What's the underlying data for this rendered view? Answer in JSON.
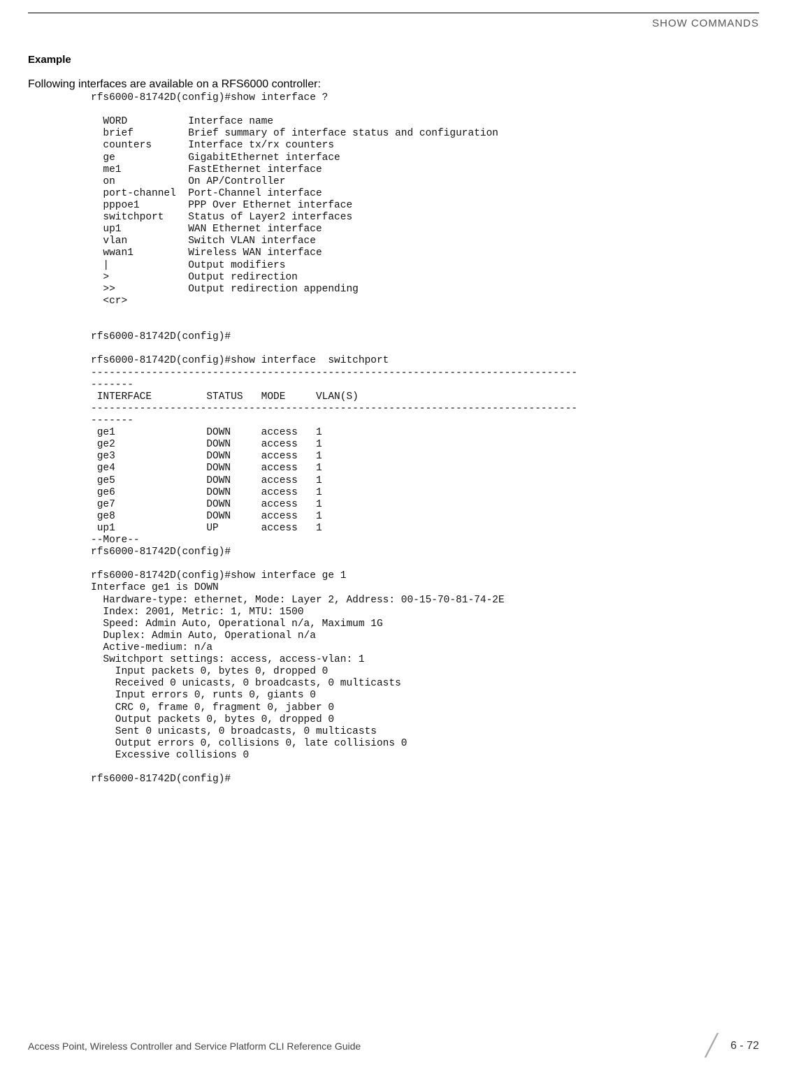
{
  "header": {
    "section_title": "SHOW COMMANDS"
  },
  "body": {
    "heading": "Example",
    "intro": "Following interfaces are available on a RFS6000 controller:",
    "cli": "rfs6000-81742D(config)#show interface ?\n\n  WORD          Interface name\n  brief         Brief summary of interface status and configuration\n  counters      Interface tx/rx counters\n  ge            GigabitEthernet interface\n  me1           FastEthernet interface\n  on            On AP/Controller\n  port-channel  Port-Channel interface\n  pppoe1        PPP Over Ethernet interface\n  switchport    Status of Layer2 interfaces\n  up1           WAN Ethernet interface\n  vlan          Switch VLAN interface\n  wwan1         Wireless WAN interface\n  |             Output modifiers\n  >             Output redirection\n  >>            Output redirection appending\n  <cr>\n\n\nrfs6000-81742D(config)#\n\nrfs6000-81742D(config)#show interface  switchport\n--------------------------------------------------------------------------------\n-------\n INTERFACE         STATUS   MODE     VLAN(S)\n--------------------------------------------------------------------------------\n-------\n ge1               DOWN     access   1\n ge2               DOWN     access   1\n ge3               DOWN     access   1\n ge4               DOWN     access   1\n ge5               DOWN     access   1\n ge6               DOWN     access   1\n ge7               DOWN     access   1\n ge8               DOWN     access   1\n up1               UP       access   1\n--More--\nrfs6000-81742D(config)#\n\nrfs6000-81742D(config)#show interface ge 1\nInterface ge1 is DOWN\n  Hardware-type: ethernet, Mode: Layer 2, Address: 00-15-70-81-74-2E\n  Index: 2001, Metric: 1, MTU: 1500\n  Speed: Admin Auto, Operational n/a, Maximum 1G\n  Duplex: Admin Auto, Operational n/a\n  Active-medium: n/a\n  Switchport settings: access, access-vlan: 1\n    Input packets 0, bytes 0, dropped 0\n    Received 0 unicasts, 0 broadcasts, 0 multicasts\n    Input errors 0, runts 0, giants 0\n    CRC 0, frame 0, fragment 0, jabber 0\n    Output packets 0, bytes 0, dropped 0\n    Sent 0 unicasts, 0 broadcasts, 0 multicasts\n    Output errors 0, collisions 0, late collisions 0\n    Excessive collisions 0\n\nrfs6000-81742D(config)#"
  },
  "footer": {
    "left": "Access Point, Wireless Controller and Service Platform CLI Reference Guide",
    "page": "6 - 72"
  }
}
